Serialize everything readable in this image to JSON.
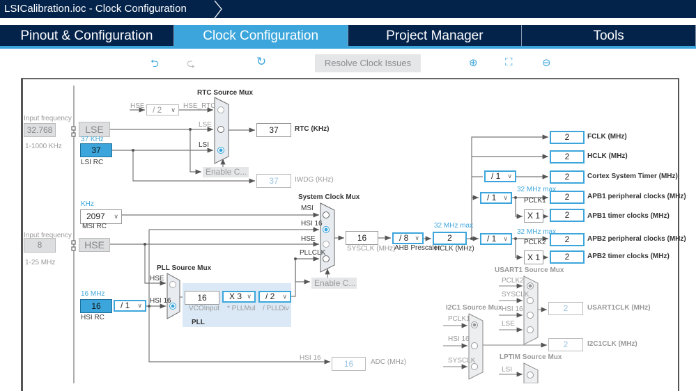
{
  "window": {
    "title": "LSICalibration.ioc - Clock Configuration"
  },
  "tabs": [
    {
      "label": "Pinout & Configuration"
    },
    {
      "label": "Clock Configuration"
    },
    {
      "label": "Project Manager"
    },
    {
      "label": "Tools"
    }
  ],
  "toolbar": {
    "undo": "⮌",
    "redo": "⮎",
    "reset": "↻",
    "resolve": "Resolve Clock Issues",
    "zoom_in": "⊕",
    "fit": "⛶",
    "zoom_out": "⊖"
  },
  "lse": {
    "input_label": "Input frequency",
    "input_value": "32.768",
    "range": "1-1000 KHz",
    "label": "LSE"
  },
  "lsi": {
    "freq_label": "37 KHz",
    "value": "37",
    "label": "LSI RC"
  },
  "rtc": {
    "title": "RTC Source Mux",
    "hse_in": "HSE",
    "div": "/ 2",
    "hse_rtc": "HSE_RTC",
    "lse_in": "LSE",
    "lsi_in": "LSI",
    "output": "37",
    "output_label": "RTC (KHz)",
    "enable": "Enable C...",
    "iwdg": "37",
    "iwdg_label": "IWDG (KHz)"
  },
  "msi": {
    "unit": "KHz",
    "value": "2097",
    "label": "MSI RC"
  },
  "hse": {
    "input_label": "Input frequency",
    "input_value": "8",
    "range": "1-25 MHz",
    "label": "HSE"
  },
  "hsi": {
    "freq_label": "16 MHz",
    "value": "16",
    "label": "HSI RC",
    "div": "/ 1"
  },
  "pll": {
    "title": "PLL Source Mux",
    "hse_in": "HSE",
    "hsi_in": "HSI 16",
    "vco": "16",
    "vco_label": "VCOInput",
    "mul": "X 3",
    "mul_label": "* PLLMul",
    "div": "/ 2",
    "div_label": "/ PLLDiv",
    "label": "PLL"
  },
  "sysmux": {
    "title": "System Clock Mux",
    "msi": "MSI",
    "hsi": "HSI 16",
    "hse": "HSE",
    "pllclk": "PLLCLK",
    "enable": "Enable C...",
    "sysclk": "16",
    "sysclk_label": "SYSCLK (MHz)",
    "ahb": "/ 8",
    "ahb_label": "AHB Prescaler",
    "hclk_max": "32 MHz max",
    "hclk": "2",
    "hclk_label": "HCLK (MHz)"
  },
  "adc": {
    "in": "HSI 16",
    "value": "16",
    "label": "ADC (MHz)"
  },
  "outputs": {
    "fclk": "2",
    "fclk_label": "FCLK (MHz)",
    "hclk": "2",
    "hclk_label": "HCLK (MHz)",
    "cortex_div": "/ 1",
    "cortex": "2",
    "cortex_label": "Cortex System Timer (MHz)",
    "apb1_div": "/ 1",
    "apb1_max": "32 MHz max",
    "pclk1": "PCLK1",
    "apb1": "2",
    "apb1_label": "APB1 peripheral clocks (MHz)",
    "apb1_mul": "X 1",
    "apb1_tim": "2",
    "apb1_tim_label": "APB1 timer clocks (MHz)",
    "apb2_div": "/ 1",
    "apb2_max": "32 MHz max",
    "pclk2": "PCLK2",
    "apb2": "2",
    "apb2_label": "APB2 peripheral clocks (MHz)",
    "apb2_mul": "X 1",
    "apb2_tim": "2",
    "apb2_tim_label": "APB2 timer clocks (MHz)"
  },
  "usart1": {
    "title": "USART1 Source Mux",
    "in1": "PCLK2",
    "in2": "SYSCLK",
    "in3": "HSI 16",
    "in4": "LSE",
    "value": "2",
    "label": "USART1CLK (MHz)"
  },
  "i2c1": {
    "title": "I2C1 Source Mux",
    "in1": "PCLK1",
    "in2": "HSI 16",
    "in3": "SYSCLK",
    "value": "2",
    "label": "I2C1CLK (MHz)"
  },
  "lptim": {
    "title": "LPTIM Source Mux",
    "in1": "LSI"
  }
}
